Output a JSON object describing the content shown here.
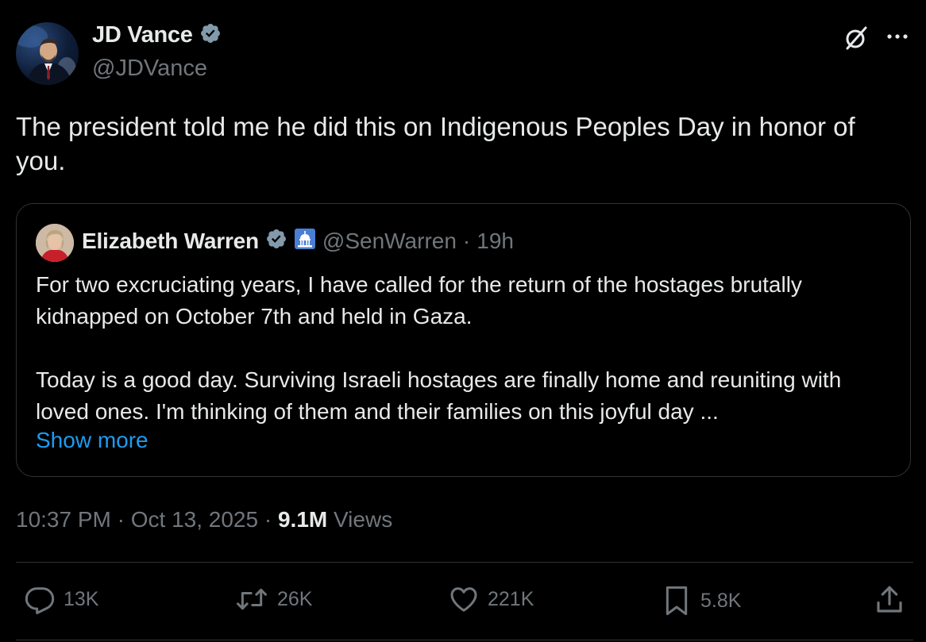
{
  "author": {
    "name": "JD Vance",
    "handle": "@JDVance",
    "verified": true,
    "verified_color": "#829aab"
  },
  "tweet": {
    "text": "The president told me he did this on Indigenous Peoples Day in honor of you."
  },
  "quoted": {
    "name": "Elizabeth Warren",
    "verified": true,
    "badge_icon": "capitol-building-icon",
    "handle": "@SenWarren",
    "separator": "·",
    "time": "19h",
    "paragraph_1": "For two excruciating years, I have called for the return of the hostages brutally kidnapped on October 7th and held in Gaza.",
    "paragraph_2": "Today is a good day. Surviving Israeli hostages are finally home and reuniting with loved ones. I'm thinking of them and their families on this joyful day ...",
    "show_more": "Show more"
  },
  "meta": {
    "time": "10:37 PM",
    "dot_1": "·",
    "date": "Oct 13, 2025",
    "dot_2": "·",
    "views_count": "9.1M",
    "views_label": "Views"
  },
  "actions": {
    "replies": "13K",
    "reposts": "26K",
    "likes": "221K",
    "bookmarks": "5.8K"
  },
  "colors": {
    "background": "#000000",
    "text_primary": "#e7e9ea",
    "text_secondary": "#71767b",
    "link": "#1d9bf0",
    "border": "#2f3336"
  }
}
